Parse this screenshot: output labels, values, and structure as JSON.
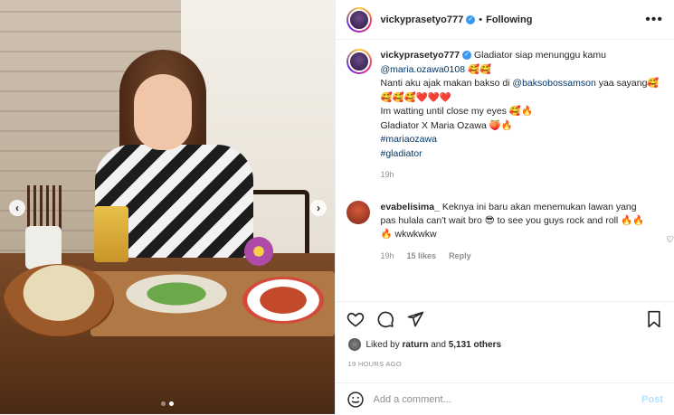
{
  "header": {
    "username": "vickyprasetyo777",
    "separator": "•",
    "follow_label": "Following",
    "more_label": "•••"
  },
  "caption": {
    "username": "vickyprasetyo777",
    "line1": "Gladiator siap menunggu kamu",
    "mention1": "@maria.ozawa0108",
    "emoji1": "🥰🥰",
    "line2a": "Nanti aku ajak makan bakso di",
    "mention2": "@baksobossamson",
    "line2b": "yaa sayang🥰",
    "line3": "🥰🥰🥰❤️❤️❤️",
    "line4": "Im watting until close my eyes 🥰🔥",
    "line5": "Gladiator X Maria Ozawa 🍑🔥",
    "hashtag1": "#mariaozawa",
    "hashtag2": "#gladiator",
    "age": "19h"
  },
  "comment": {
    "username": "evabelisima_",
    "text": "Keknya ini baru akan menemukan lawan yang pas hulala can't wait bro 😎 to see you guys rock and roll 🔥🔥🔥 wkwkwkw",
    "age": "19h",
    "likes": "15 likes",
    "reply": "Reply",
    "heart": "♡"
  },
  "likes": {
    "prefix": "Liked by",
    "user": "raturn",
    "conj": "and",
    "others": "5,131 others"
  },
  "timestamp": "19 HOURS AGO",
  "add_comment": {
    "placeholder": "Add a comment...",
    "post_label": "Post"
  },
  "carousel": {
    "prev": "‹",
    "next": "›",
    "count": 2,
    "active": 2
  },
  "colors": {
    "link": "#00376b",
    "verified": "#3897f0",
    "post": "#b2dffc"
  }
}
